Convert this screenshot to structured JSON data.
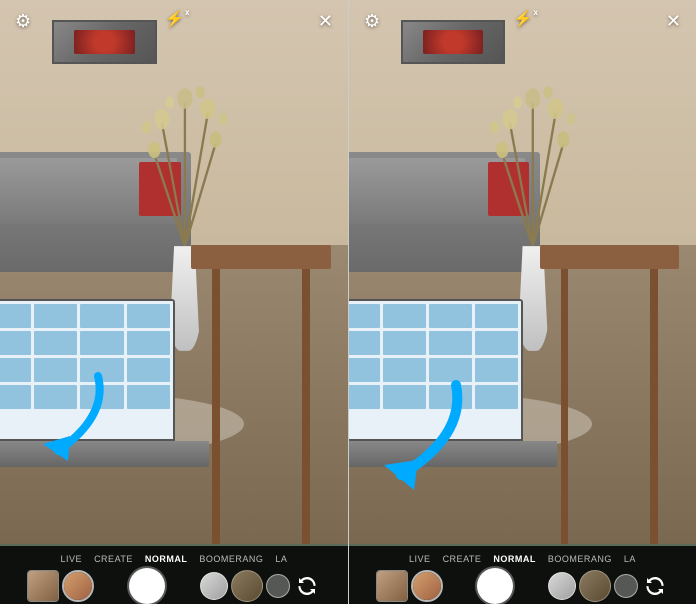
{
  "panels": [
    {
      "id": "panel-left",
      "top_controls": {
        "settings_icon": "⚙",
        "flash_icon": "⚡",
        "flash_x": "x",
        "close_icon": "✕"
      },
      "bottom_bar": {
        "modes": [
          {
            "label": "LIVE",
            "active": false
          },
          {
            "label": "CREATE",
            "active": false
          },
          {
            "label": "NORMAL",
            "active": true
          },
          {
            "label": "BOOMERANG",
            "active": false
          },
          {
            "label": "LA",
            "active": false
          }
        ],
        "flip_icon": "↺"
      },
      "arrow_color": "#00aaff"
    },
    {
      "id": "panel-right",
      "top_controls": {
        "settings_icon": "⚙",
        "flash_icon": "⚡",
        "flash_x": "x",
        "close_icon": "✕"
      },
      "bottom_bar": {
        "modes": [
          {
            "label": "LIVE",
            "active": false
          },
          {
            "label": "CREATE",
            "active": false
          },
          {
            "label": "NORMAL",
            "active": true
          },
          {
            "label": "BOOMERANG",
            "active": false
          },
          {
            "label": "LA",
            "active": false
          }
        ],
        "flip_icon": "↺"
      },
      "arrow_color": "#00aaff"
    }
  ]
}
